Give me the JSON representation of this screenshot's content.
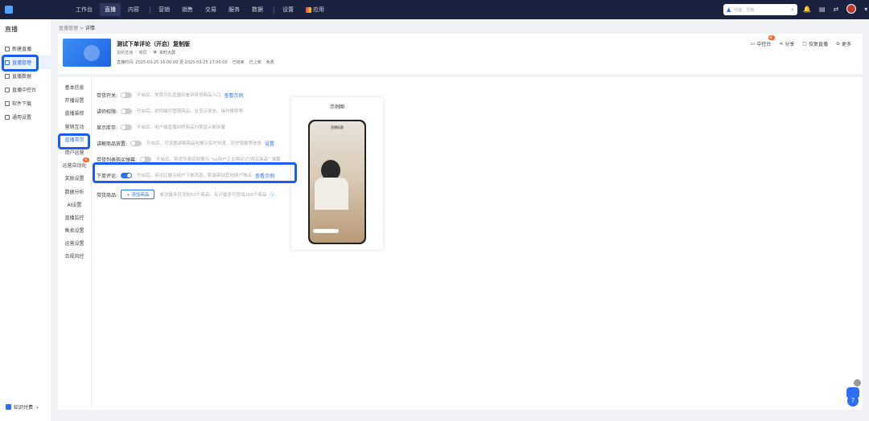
{
  "topbar": {
    "nav": [
      "工作台",
      "直播",
      "内容",
      "营销",
      "销售",
      "交易",
      "服务",
      "数据",
      "设置"
    ],
    "app_label": "应用",
    "search_placeholder": "功能、文档"
  },
  "sidebar": {
    "title": "直播",
    "items": [
      "新建直播",
      "直播管理",
      "直播数据",
      "直播中控台",
      "软件下载",
      "通用设置"
    ],
    "bottom": "知识付费"
  },
  "breadcrumb": {
    "parent": "直播管理",
    "sep": ">",
    "current": "详情"
  },
  "live": {
    "title": "测试下单评论（开启）复制版",
    "type": "视频直播",
    "mode": "横屏",
    "screen": "实时大屏",
    "time_label": "直播时间:",
    "time": "2025-03-25 16:00:00 至 2025-03-25 17:00:00",
    "status": "已结束",
    "shelf": "已上架",
    "price": "免费"
  },
  "actions": {
    "console": "中控台",
    "console_badge": "新",
    "share": "分享",
    "restore": "恢复直播",
    "more": "更多"
  },
  "subnav": {
    "items": [
      "基本信息",
      "开播设置",
      "直播装修",
      "营销互动",
      "直播带货",
      "用户运营",
      "运营自动化",
      "奖励设置",
      "数据分析",
      "AI设置",
      "直播监控",
      "售卖设置",
      "运营设置",
      "合规风控"
    ],
    "badge": "新"
  },
  "settings": {
    "rows": [
      {
        "label": "带货开关:",
        "desc": "开启后，学员可在直播间看到带货商品入口",
        "link": "查看示例"
      },
      {
        "label": "讲师权限:",
        "desc": "开启后，讲师端可管理商品，含显示状态、操作推荐等",
        "link": ""
      },
      {
        "label": "显示库存:",
        "desc": "开启后，用户端直播间的商品列表显示剩余量",
        "link": ""
      },
      {
        "label": "讲解商品放置:",
        "desc": "开启后，可设置讲解商品时展示实时热度、历史销量等信息",
        "link": "设置"
      },
      {
        "label": "带货列表购买弹幕:",
        "desc": "开启后，带货列表底部展示 \"xx用户正在购买/已购买商品\" 弹幕",
        "link": ""
      },
      {
        "label": "下单评论:",
        "desc": "开启后，评论区展示用户下单消息，刺激带动其他用户购买",
        "link": "查看示例"
      }
    ],
    "goods_label": "带货商品:",
    "add_button": "+ 添加商品",
    "goods_desc": "单次最多可添加50个商品，合计最多可添加200个商品"
  },
  "preview": {
    "title": "示例图",
    "phone_title": "直播标题"
  },
  "colors": {
    "accent": "#2c6ff5",
    "topbar": "#1b2240",
    "highlight": "#1a5df0"
  }
}
